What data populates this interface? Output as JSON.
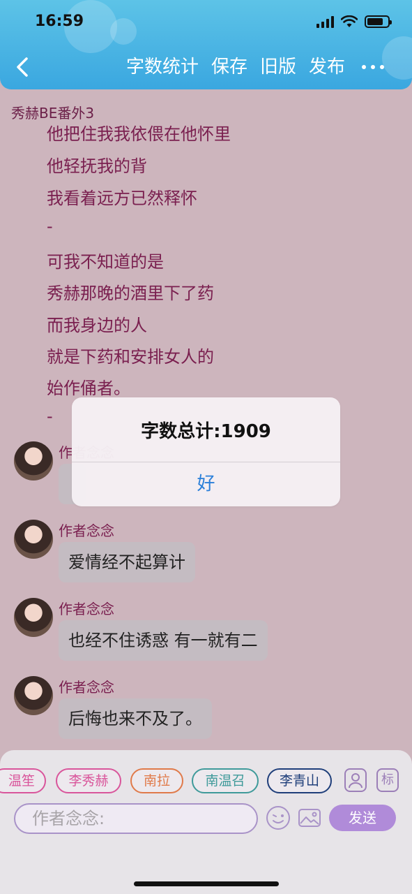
{
  "status_bar": {
    "time": "16:59"
  },
  "header": {
    "nav_items": [
      "字数统计",
      "保存",
      "旧版",
      "发布"
    ]
  },
  "document": {
    "title": "秀赫BE番外3",
    "lines": [
      "他把住我我依偎在他怀里",
      "他轻抚我的背",
      "我看着远方已然释怀",
      "-",
      "可我不知道的是",
      "秀赫那晚的酒里下了药",
      "而我身边的人",
      "就是下药和安排女人的",
      "始作俑者。",
      "-"
    ]
  },
  "messages": [
    {
      "author": "作者念念",
      "text": ""
    },
    {
      "author": "作者念念",
      "text": "爱情经不起算计"
    },
    {
      "author": "作者念念",
      "text": "也经不住诱惑 有一就有二"
    },
    {
      "author": "作者念念",
      "text": "后悔也来不及了。"
    }
  ],
  "toolbar": {
    "chips": [
      {
        "label": "温笙",
        "color": "#d9559b"
      },
      {
        "label": "李秀赫",
        "color": "#d9559b"
      },
      {
        "label": "南拉",
        "color": "#e07a4a"
      },
      {
        "label": "南温召",
        "color": "#3f9a9a"
      },
      {
        "label": "李青山",
        "color": "#1f3e7a"
      }
    ],
    "label_button": "标",
    "input_placeholder": "作者念念:",
    "send_label": "发送"
  },
  "alert": {
    "title": "字数总计:1909",
    "ok_label": "好"
  },
  "colors": {
    "header_blue": "#3aa7e0",
    "background": "#cdb5bd",
    "text_wine": "#7a1f4f",
    "send_purple": "#b08bd9",
    "alert_link_blue": "#2a7fd9"
  }
}
